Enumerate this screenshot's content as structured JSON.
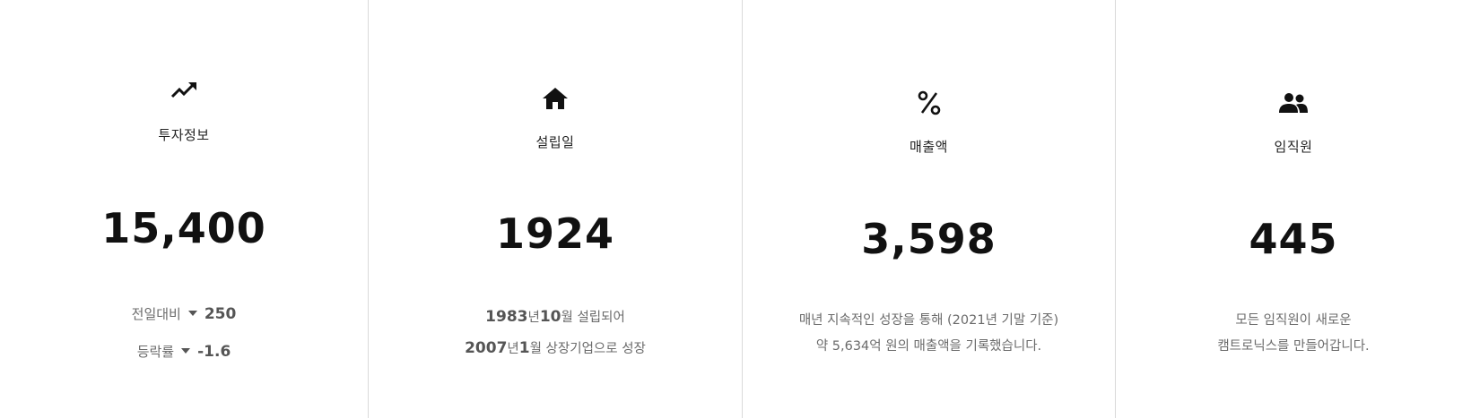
{
  "cards": [
    {
      "icon": "trending-up-icon",
      "label": "투자정보",
      "value": "15,400",
      "stats": [
        {
          "label": "전일대비",
          "value": "250"
        },
        {
          "label": "등락률",
          "value": "-1.6"
        }
      ]
    },
    {
      "icon": "home-icon",
      "label": "설립일",
      "value": "1924",
      "lines": [
        {
          "y1": "1983",
          "t1": "년",
          "y2": "10",
          "t2": "월 설립되어"
        },
        {
          "y1": "2007",
          "t1": "년",
          "y2": "1",
          "t2": "월 상장기업으로 성장"
        }
      ]
    },
    {
      "icon": "percent-icon",
      "label": "매출액",
      "value": "3,598",
      "desc": [
        "매년 지속적인 성장을 통해 (2021년 기말 기준)",
        "약 5,634억 원의 매출액을 기록했습니다."
      ]
    },
    {
      "icon": "people-icon",
      "label": "임직원",
      "value": "445",
      "desc": [
        "모든 임직원이 새로운",
        "캠트로닉스를 만들어갑니다."
      ]
    }
  ]
}
